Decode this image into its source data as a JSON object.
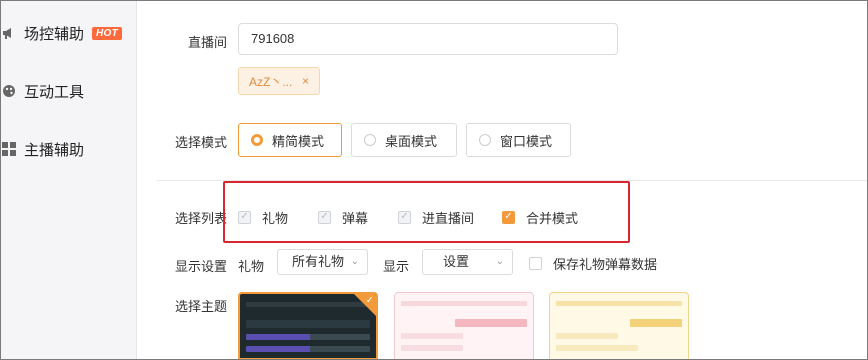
{
  "sidebar": {
    "items": [
      {
        "label": "场控辅助",
        "icon": "megaphone-icon",
        "badge": "HOT"
      },
      {
        "label": "互动工具",
        "icon": "palette-icon"
      },
      {
        "label": "主播辅助",
        "icon": "grid-icon"
      }
    ]
  },
  "room": {
    "label": "直播间",
    "value": "791608",
    "tag": "AzZ丶...",
    "tag_close": "×"
  },
  "mode": {
    "label": "选择模式",
    "options": [
      "精简模式",
      "桌面模式",
      "窗口模式"
    ],
    "selected": "精简模式"
  },
  "list": {
    "label": "选择列表",
    "options": [
      {
        "label": "礼物",
        "checked": true,
        "disabled": true
      },
      {
        "label": "弹幕",
        "checked": true,
        "disabled": true
      },
      {
        "label": "进直播间",
        "checked": true,
        "disabled": true
      },
      {
        "label": "合并模式",
        "checked": true,
        "disabled": false
      }
    ]
  },
  "display": {
    "label": "显示设置",
    "gift_label": "礼物",
    "gift_select": "所有礼物",
    "show_label": "显示",
    "show_select": "设置",
    "save_label": "保存礼物弹幕数据"
  },
  "theme": {
    "label": "选择主题",
    "options": [
      "dark",
      "pink",
      "yellow"
    ],
    "selected": "dark"
  },
  "colors": {
    "accent": "#f39a3b",
    "highlight_box": "#d7262f",
    "hot_badge": "#ff6a3c"
  }
}
